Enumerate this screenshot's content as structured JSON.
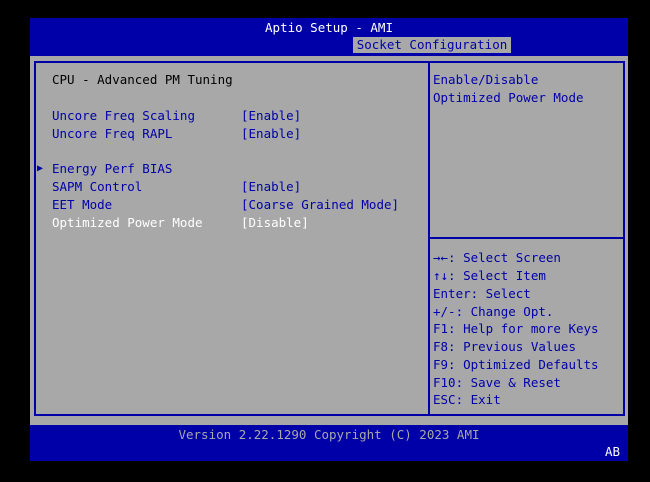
{
  "header": {
    "title": "Aptio Setup - AMI",
    "active_tab": "Socket Configuration"
  },
  "main": {
    "section_title": "CPU - Advanced PM Tuning",
    "settings": [
      {
        "label": "Uncore Freq Scaling",
        "value": "[Enable]"
      },
      {
        "label": "Uncore Freq RAPL",
        "value": "[Enable]"
      },
      {
        "label": "Energy Perf BIAS",
        "submenu_marker": "▶"
      },
      {
        "label": "SAPM Control",
        "value": "[Enable]"
      },
      {
        "label": "EET Mode",
        "value": "[Coarse Grained Mode]"
      },
      {
        "label": "Optimized Power Mode",
        "value": "[Disable]",
        "selected": true
      }
    ]
  },
  "help": {
    "lines": [
      "Enable/Disable",
      "Optimized Power Mode"
    ]
  },
  "keys": {
    "lines": [
      "→←: Select Screen",
      "↑↓: Select Item",
      "Enter: Select",
      "+/-: Change Opt.",
      "F1: Help for more Keys",
      "F8: Previous Values",
      "F9: Optimized Defaults",
      "F10: Save & Reset",
      "ESC: Exit"
    ]
  },
  "footer": {
    "version": "Version 2.22.1290 Copyright (C) 2023 AMI",
    "badge": "AB"
  },
  "colors": {
    "background": "#a8a8a8",
    "bar": "#0000a8",
    "highlight": "#ffffff",
    "text": "#000000"
  }
}
